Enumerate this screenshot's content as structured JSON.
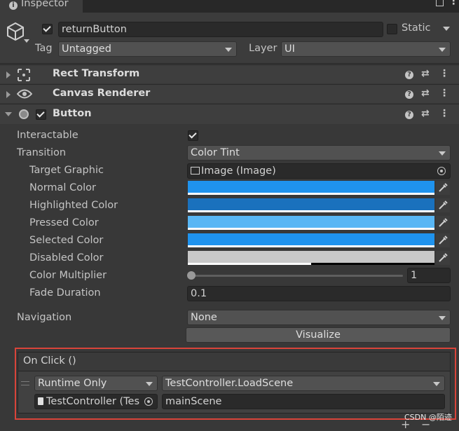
{
  "tab": {
    "title": "Inspector"
  },
  "header": {
    "object_name": "returnButton",
    "static_label": "Static",
    "tag_label": "Tag",
    "tag_value": "Untagged",
    "layer_label": "Layer",
    "layer_value": "UI"
  },
  "components": {
    "rect_transform": "Rect Transform",
    "canvas_renderer": "Canvas Renderer",
    "button": "Button"
  },
  "button_props": {
    "interactable": {
      "label": "Interactable",
      "checked": true
    },
    "transition": {
      "label": "Transition",
      "value": "Color Tint"
    },
    "target_graphic": {
      "label": "Target Graphic",
      "value": "Image (Image)"
    },
    "normal_color": {
      "label": "Normal Color",
      "color": "#1f93ee",
      "alpha": 1.0
    },
    "highlighted_color": {
      "label": "Highlighted Color",
      "color": "#1a71bd",
      "alpha": 1.0
    },
    "pressed_color": {
      "label": "Pressed Color",
      "color": "#58b6f4",
      "alpha": 1.0
    },
    "selected_color": {
      "label": "Selected Color",
      "color": "#1f93ee",
      "alpha": 1.0
    },
    "disabled_color": {
      "label": "Disabled Color",
      "color": "#c8c8c8",
      "alpha": 0.5
    },
    "color_multiplier": {
      "label": "Color Multiplier",
      "value": "1",
      "slider_fraction": 0.0
    },
    "fade_duration": {
      "label": "Fade Duration",
      "value": "0.1"
    },
    "navigation": {
      "label": "Navigation",
      "value": "None"
    },
    "visualize_label": "Visualize"
  },
  "on_click": {
    "title": "On Click ()",
    "runtime": "Runtime Only",
    "function": "TestController.LoadScene",
    "target_object": "TestController (Tes",
    "argument": "mainScene"
  },
  "footer": {
    "add": "+",
    "remove": "−"
  },
  "watermark": "CSDN @陌迹",
  "highlight_color": "#d9443a"
}
